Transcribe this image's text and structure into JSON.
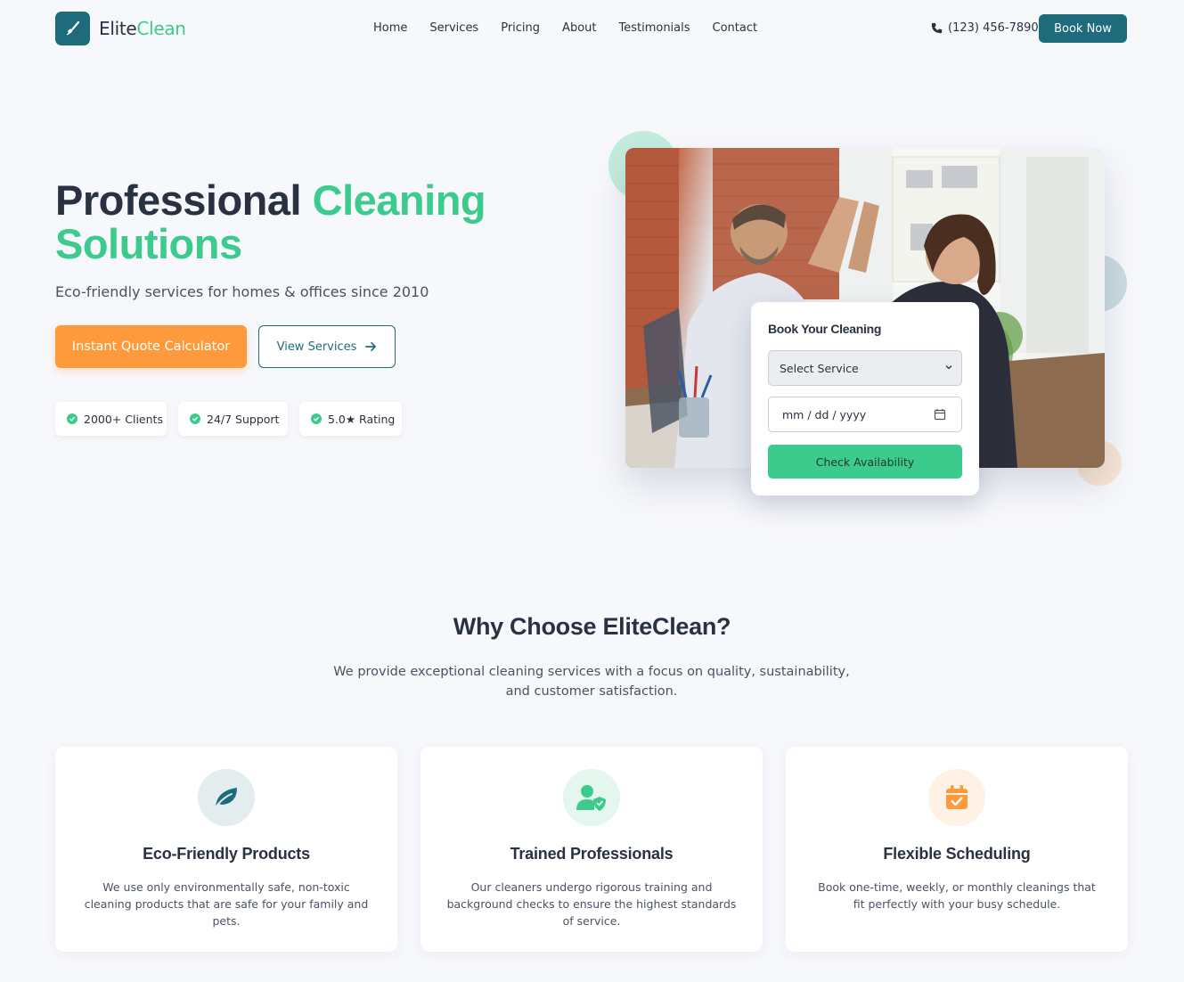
{
  "brand": {
    "name_part1": "Elite",
    "name_part2": "Clean",
    "logo_icon": "broom-icon"
  },
  "nav": {
    "items": [
      "Home",
      "Services",
      "Pricing",
      "About",
      "Testimonials",
      "Contact"
    ],
    "phone": "(123) 456-7890",
    "book_now": "Book Now"
  },
  "hero": {
    "title_part1": "Professional ",
    "title_part2": "Cleaning Solutions",
    "subtitle": "Eco-friendly services for homes & offices since 2010",
    "primary_button": "Instant Quote Calculator",
    "secondary_button": "View Services",
    "badges": [
      "2000+ Clients",
      "24/7 Support",
      "5.0★ Rating"
    ]
  },
  "booking": {
    "title": "Book Your Cleaning",
    "service_select": "Select Service",
    "date_placeholder": "mm / dd / yyyy",
    "check_button": "Check Availability"
  },
  "why": {
    "title": "Why Choose EliteClean?",
    "subtitle": "We provide exceptional cleaning services with a focus on quality, sustainability, and customer satisfaction.",
    "cards": [
      {
        "icon": "leaf-icon",
        "title": "Eco-Friendly Products",
        "text": "We use only environmentally safe, non-toxic cleaning products that are safe for your family and pets."
      },
      {
        "icon": "user-shield-icon",
        "title": "Trained Professionals",
        "text": "Our cleaners undergo rigorous training and background checks to ensure the highest standards of service."
      },
      {
        "icon": "calendar-check-icon",
        "title": "Flexible Scheduling",
        "text": "Book one-time, weekly, or monthly cleanings that fit perfectly with your busy schedule."
      }
    ]
  },
  "colors": {
    "primary": "#1e6b7c",
    "accent_green": "#3ccb8c",
    "accent_orange": "#ff9a3c",
    "text": "#2a3140"
  }
}
